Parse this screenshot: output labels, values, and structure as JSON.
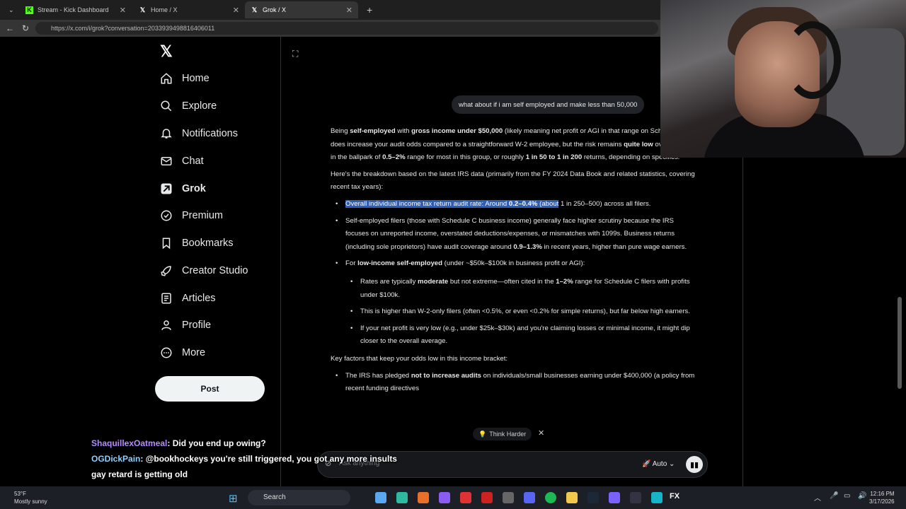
{
  "browser": {
    "tabs": [
      {
        "label": "Stream - Kick Dashboard",
        "icon": "kick-icon"
      },
      {
        "label": "Home / X",
        "icon": "x-icon"
      },
      {
        "label": "Grok / X",
        "icon": "x-icon",
        "active": true
      }
    ],
    "url": "https://x.com/i/grok?conversation=2033939498816406011"
  },
  "sidebar": {
    "items": [
      {
        "label": "Home",
        "icon": "home-icon"
      },
      {
        "label": "Explore",
        "icon": "search-icon"
      },
      {
        "label": "Notifications",
        "icon": "bell-icon"
      },
      {
        "label": "Chat",
        "icon": "mail-icon"
      },
      {
        "label": "Grok",
        "icon": "grok-icon"
      },
      {
        "label": "Premium",
        "icon": "verified-icon"
      },
      {
        "label": "Bookmarks",
        "icon": "bookmark-icon"
      },
      {
        "label": "Creator Studio",
        "icon": "rocket-icon"
      },
      {
        "label": "Articles",
        "icon": "articles-icon"
      },
      {
        "label": "Profile",
        "icon": "person-icon"
      },
      {
        "label": "More",
        "icon": "more-icon"
      }
    ],
    "post_label": "Post"
  },
  "conversation": {
    "user_message": "what about if i am self employed and make less than 50,000",
    "p1": {
      "t1": "Being ",
      "b1": "self-employed",
      "t2": " with ",
      "b2": "gross income under $50,000",
      "t3": " (likely meaning net profit or AGI in that range on Schedule C) does increase your audit odds compared to a straightforward W-2 employee, but the risk remains ",
      "b3": "quite low",
      "t4": " overall—still in the ballpark of ",
      "b4": "0.5–2%",
      "t5": " range for most in this group, or roughly ",
      "b5": "1 in 50 to 1 in 200",
      "t6": " returns, depending on specifics."
    },
    "p2": "Here's the breakdown based on the latest IRS data (primarily from the FY 2024 Data Book and related statistics, covering recent tax years):",
    "bullet1": {
      "h1": "Overall individual income tax return audit rate: Around ",
      "hb": "0.2–0.4%",
      "h2": " (about",
      "t": " 1 in 250–500) across all filers."
    },
    "bullet2": {
      "t1": "Self-employed filers (those with Schedule C business income) generally face higher scrutiny because the IRS focuses on unreported income, overstated deductions/expenses, or mismatches with 1099s. Business returns (including sole proprietors) have audit coverage around ",
      "b1": "0.9–1.3%",
      "t2": " in recent years, higher than pure wage earners."
    },
    "bullet3": {
      "t1": "For ",
      "b1": "low-income self-employed",
      "t2": " (under ~$50k–$100k in business profit or AGI):"
    },
    "sub1": {
      "t1": "Rates are typically ",
      "b1": "moderate",
      "t2": " but not extreme—often cited in the ",
      "b2": "1–2%",
      "t3": " range for Schedule C filers with profits under $100k."
    },
    "sub2": "This is higher than W-2-only filers (often <0.5%, or even <0.2% for simple returns), but far below high earners.",
    "sub3": "If your net profit is very low (e.g., under $25k–$30k) and you're claiming losses or minimal income, it might dip closer to the overall average.",
    "p3": "Key factors that keep your odds low in this income bracket:",
    "bullet4": {
      "t1": "The IRS has pledged ",
      "b1": "not to increase audits",
      "t2": " on individuals/small businesses earning under $400,000 (a policy from recent funding directives"
    }
  },
  "composer": {
    "think_label": "Think Harder",
    "placeholder": "Ask anything",
    "mode": "Auto"
  },
  "stream_chat": [
    {
      "user": "ShaquillexOatmeal",
      "message": ": Did you end up owing?"
    },
    {
      "user": "OGDickPain",
      "message": ": @bookhockeys you're still triggered, you got any more insults gay retard is getting old"
    }
  ],
  "taskbar": {
    "temp": "53°F",
    "weather": "Mostly sunny",
    "search": "Search",
    "time": "12:16 PM",
    "date": "3/17/2026"
  }
}
